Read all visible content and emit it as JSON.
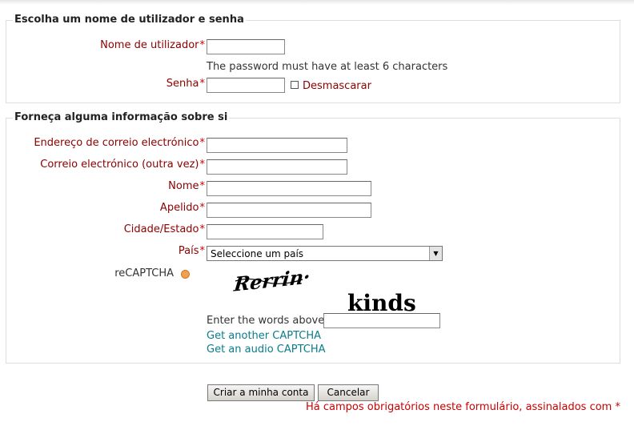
{
  "account_section": {
    "legend": "Escolha um nome de utilizador e senha",
    "username_label": "Nome de utilizador",
    "password_hint": "The password must have at least 6 characters",
    "password_label": "Senha",
    "unmask_label": "Desmascarar"
  },
  "info_section": {
    "legend": "Forneça alguma informação sobre si",
    "email_label": "Endereço de correio electrónico",
    "email2_label": "Correio electrónico (outra vez)",
    "firstname_label": "Nome",
    "lastname_label": "Apelido",
    "city_label": "Cidade/Estado",
    "country_label": "País",
    "country_selected": "Seleccione um país",
    "recaptcha_label": "reCAPTCHA",
    "captcha_word1": "Rerrin·",
    "captcha_word2": "kinds",
    "enter_words_label": "Enter the words above",
    "another_captcha_link": "Get another CAPTCHA",
    "audio_captcha_link": "Get an audio CAPTCHA"
  },
  "required_marker": "*",
  "buttons": {
    "submit": "Criar a minha conta",
    "cancel": "Cancelar"
  },
  "required_note": "Há campos obrigatórios neste formulário, assinalados com",
  "colors": {
    "label": "#8b0000",
    "required": "#cc0000",
    "link": "#0a7c8c"
  }
}
